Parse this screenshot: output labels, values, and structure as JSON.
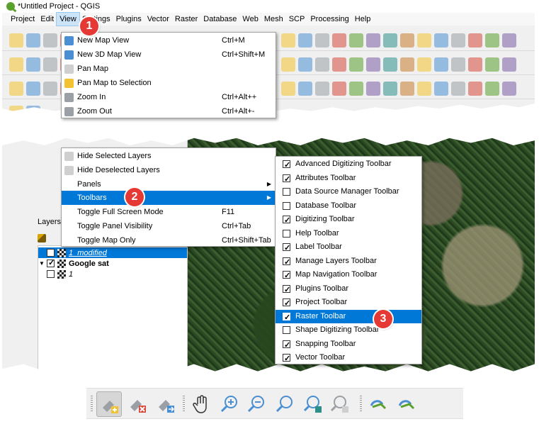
{
  "window": {
    "title": "*Untitled Project - QGIS"
  },
  "menubar": {
    "items": [
      {
        "label": "Project",
        "name": "menu-project"
      },
      {
        "label": "Edit",
        "name": "menu-edit"
      },
      {
        "label": "View",
        "name": "menu-view",
        "active": true
      },
      {
        "label": "Settings",
        "name": "menu-settings"
      },
      {
        "label": "Plugins",
        "name": "menu-plugins"
      },
      {
        "label": "Vector",
        "name": "menu-vector"
      },
      {
        "label": "Raster",
        "name": "menu-raster"
      },
      {
        "label": "Database",
        "name": "menu-database"
      },
      {
        "label": "Web",
        "name": "menu-web"
      },
      {
        "label": "Mesh",
        "name": "menu-mesh"
      },
      {
        "label": "SCP",
        "name": "menu-scp"
      },
      {
        "label": "Processing",
        "name": "menu-processing"
      },
      {
        "label": "Help",
        "name": "menu-help"
      }
    ]
  },
  "view_menu": {
    "top_items": [
      {
        "label": "New Map View",
        "shortcut": "Ctrl+M",
        "icon": "new-map-view-icon"
      },
      {
        "label": "New 3D Map View",
        "shortcut": "Ctrl+Shift+M",
        "icon": "new-3d-map-view-icon"
      },
      {
        "label": "Pan Map",
        "shortcut": "",
        "icon": "pan-hand-icon"
      },
      {
        "label": "Pan Map to Selection",
        "shortcut": "",
        "icon": "pan-to-selection-icon"
      },
      {
        "label": "Zoom In",
        "shortcut": "Ctrl+Alt++",
        "icon": "zoom-in-icon"
      },
      {
        "label": "Zoom Out",
        "shortcut": "Ctrl+Alt+-",
        "icon": "zoom-out-icon"
      }
    ],
    "bottom_items": [
      {
        "label": "Hide Selected Layers",
        "shortcut": "",
        "icon": "hide-selected-layers-icon"
      },
      {
        "label": "Hide Deselected Layers",
        "shortcut": "",
        "icon": "hide-deselected-layers-icon"
      },
      {
        "label": "Panels",
        "shortcut": "",
        "submenu": true
      },
      {
        "label": "Toolbars",
        "shortcut": "",
        "submenu": true,
        "highlight": true
      },
      {
        "label": "Toggle Full Screen Mode",
        "shortcut": "F11"
      },
      {
        "label": "Toggle Panel Visibility",
        "shortcut": "Ctrl+Tab"
      },
      {
        "label": "Toggle Map Only",
        "shortcut": "Ctrl+Shift+Tab"
      }
    ]
  },
  "toolbars_submenu": {
    "items": [
      {
        "label": "Advanced Digitizing Toolbar",
        "checked": true
      },
      {
        "label": "Attributes Toolbar",
        "checked": true
      },
      {
        "label": "Data Source Manager Toolbar",
        "checked": false
      },
      {
        "label": "Database Toolbar",
        "checked": false
      },
      {
        "label": "Digitizing Toolbar",
        "checked": true
      },
      {
        "label": "Help Toolbar",
        "checked": false
      },
      {
        "label": "Label Toolbar",
        "checked": true
      },
      {
        "label": "Manage Layers Toolbar",
        "checked": true
      },
      {
        "label": "Map Navigation Toolbar",
        "checked": true
      },
      {
        "label": "Plugins Toolbar",
        "checked": true
      },
      {
        "label": "Project Toolbar",
        "checked": true
      },
      {
        "label": "Raster Toolbar",
        "checked": true,
        "highlight": true
      },
      {
        "label": "Shape Digitizing Toolbar",
        "checked": false
      },
      {
        "label": "Snapping Toolbar",
        "checked": true
      },
      {
        "label": "Vector Toolbar",
        "checked": true
      }
    ]
  },
  "layers_panel": {
    "title": "Layers",
    "rows": [
      {
        "label": "1_modified",
        "checked": false,
        "selected": true,
        "italic": true,
        "expander": ""
      },
      {
        "label": "Google sat",
        "checked": true,
        "selected": false,
        "bold": true,
        "expander": "▼"
      },
      {
        "label": "1",
        "checked": false,
        "selected": false,
        "italic": true,
        "expander": ""
      }
    ]
  },
  "callouts": [
    "1",
    "2",
    "3"
  ],
  "map_nav_toolbar": {
    "buttons": [
      {
        "name": "add-feature-button",
        "icon": "add-feature-icon",
        "pressed": true
      },
      {
        "name": "delete-feature-button",
        "icon": "delete-feature-icon"
      },
      {
        "name": "move-feature-button",
        "icon": "move-feature-icon"
      },
      {
        "name": "pan-button",
        "icon": "pan-hand-icon"
      },
      {
        "name": "zoom-in-button",
        "icon": "zoom-in-icon"
      },
      {
        "name": "zoom-out-button",
        "icon": "zoom-out-icon"
      },
      {
        "name": "zoom-full-button",
        "icon": "zoom-full-icon"
      },
      {
        "name": "zoom-to-layer-button",
        "icon": "zoom-to-layer-icon"
      },
      {
        "name": "zoom-to-selection-button",
        "icon": "zoom-to-selection-icon"
      },
      {
        "name": "zoom-last-button",
        "icon": "zoom-last-icon"
      },
      {
        "name": "zoom-next-button",
        "icon": "zoom-next-icon"
      }
    ]
  },
  "colors": {
    "highlight": "#0078d7",
    "callout": "#e53935",
    "qgis_green": "#5aa02c"
  }
}
